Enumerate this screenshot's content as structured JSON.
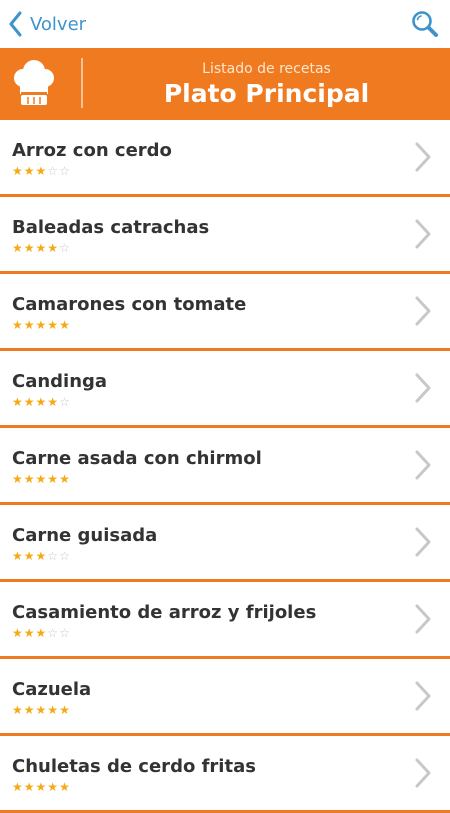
{
  "topbar": {
    "back_label": "Volver",
    "back_icon": "chevron-left-icon",
    "search_icon": "search-icon",
    "accent_color": "#3d93cc"
  },
  "header": {
    "subtitle": "Listado de recetas",
    "title": "Plato Principal",
    "icon": "chef-hat-icon",
    "background_color": "#f07a1f"
  },
  "recipes": [
    {
      "name": "Arroz con cerdo",
      "rating": 3,
      "max_rating": 5
    },
    {
      "name": "Baleadas catrachas",
      "rating": 4,
      "max_rating": 5
    },
    {
      "name": "Camarones con tomate",
      "rating": 5,
      "max_rating": 5
    },
    {
      "name": "Candinga",
      "rating": 4,
      "max_rating": 5
    },
    {
      "name": "Carne asada con chirmol",
      "rating": 5,
      "max_rating": 5
    },
    {
      "name": "Carne guisada",
      "rating": 3,
      "max_rating": 5
    },
    {
      "name": "Casamiento de arroz y frijoles",
      "rating": 3,
      "max_rating": 5
    },
    {
      "name": "Cazuela",
      "rating": 5,
      "max_rating": 5
    },
    {
      "name": "Chuletas de cerdo fritas",
      "rating": 5,
      "max_rating": 5
    }
  ],
  "colors": {
    "divider": "#f07a1f",
    "star_filled": "#f5a915",
    "star_empty": "#c7c7c7",
    "chevron": "#c8c8c8"
  }
}
